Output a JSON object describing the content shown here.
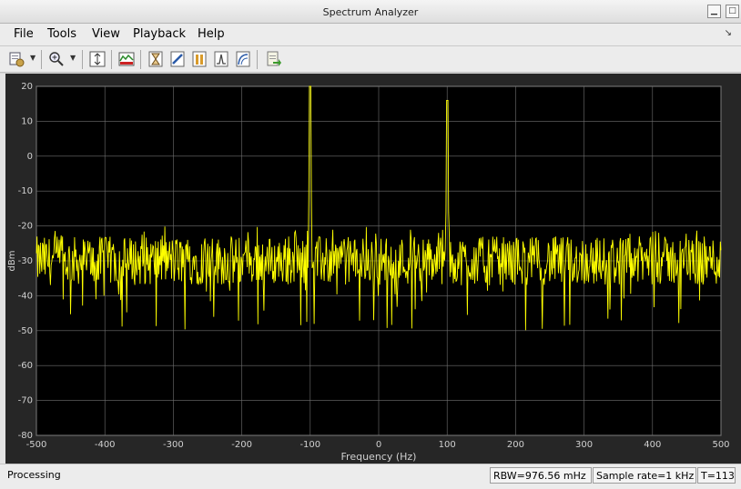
{
  "window": {
    "title": "Spectrum Analyzer",
    "controls": [
      "minimize-icon",
      "maximize-icon",
      "close-icon"
    ]
  },
  "menu": {
    "items": [
      "File",
      "Tools",
      "View",
      "Playback",
      "Help"
    ],
    "dock_icon": "dock-arrow-icon"
  },
  "toolbar": {
    "icons": [
      "print-icon",
      "zoom-in-icon",
      "autoscale-icon",
      "spectrum-settings-icon",
      "cursor-icon",
      "measure-icon",
      "peak-finder-icon",
      "channel-icon",
      "distortion-icon",
      "export-icon"
    ]
  },
  "status": {
    "left": "Processing",
    "rbw": "RBW=976.56 mHz",
    "sample_rate": "Sample rate=1 kHz",
    "time": "T=113"
  },
  "colors": {
    "background": "#000000",
    "trace": "#ffff00",
    "grid": "#707070",
    "axis_text": "#d0d0d0"
  },
  "chart_data": {
    "type": "line",
    "xlabel": "Frequency (Hz)",
    "ylabel": "dBm",
    "xlim": [
      -500,
      500
    ],
    "ylim": [
      -80,
      20
    ],
    "xticks": [
      "-500",
      "-400",
      "-300",
      "-200",
      "-100",
      "0",
      "100",
      "200",
      "300",
      "400",
      "500"
    ],
    "yticks": [
      "20",
      "10",
      "0",
      "-10",
      "-20",
      "-30",
      "-40",
      "-50",
      "-60",
      "-70",
      "-80"
    ],
    "grid": true,
    "series": [
      {
        "noise_floor_dbm": -30,
        "noise_range_dbm": [
          -50,
          -18
        ],
        "peaks": [
          {
            "x": -100,
            "y": 20
          },
          {
            "x": 100,
            "y": 16
          }
        ]
      }
    ]
  }
}
